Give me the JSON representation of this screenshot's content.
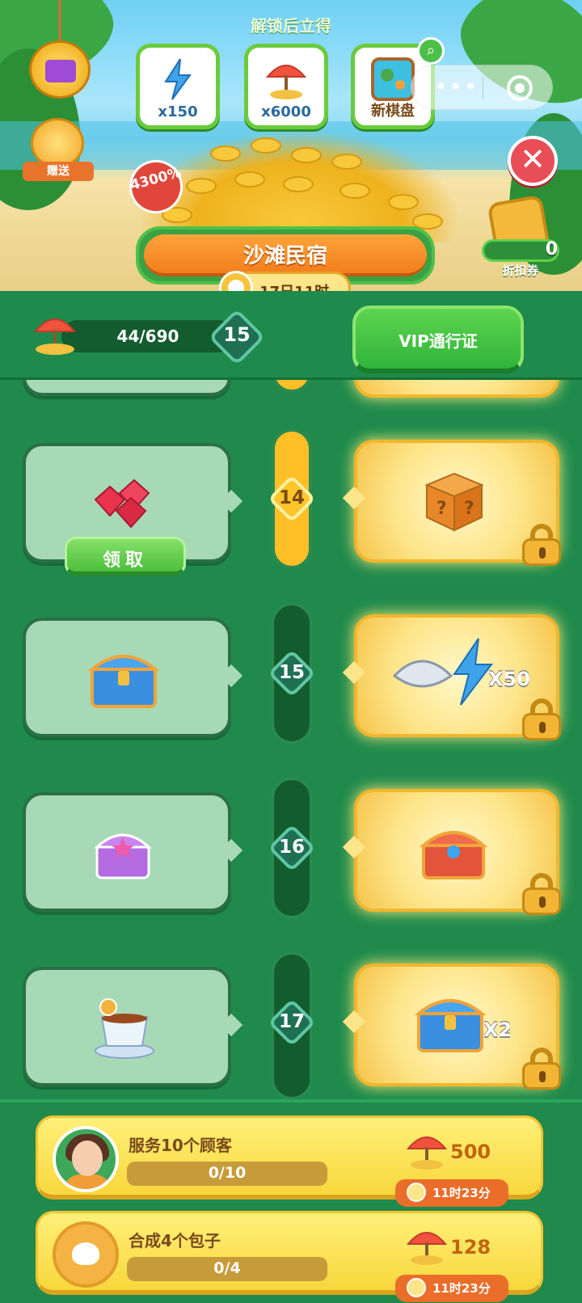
{
  "hero": {
    "unlock_title": "解锁后立得",
    "rewards": [
      {
        "label": "x150",
        "icon": "lightning-energy-icon"
      },
      {
        "label": "x6000",
        "icon": "beach-umbrella-icon"
      },
      {
        "label": "新棋盘",
        "icon": "new-board-icon"
      }
    ],
    "gift_label": "赠送",
    "percent_badge": "4300%",
    "event_title": "沙滩民宿",
    "timer": "17日11时",
    "coupon_count": "0",
    "coupon_label": "折扣券"
  },
  "progress": {
    "value": "44/690",
    "level": "15",
    "vip_button": "VIP通行证"
  },
  "levels": [
    {
      "level": "14",
      "free_reward": "ruby-gems-icon",
      "vip_reward": "mystery-box-icon",
      "claim_label": "领取",
      "active": true
    },
    {
      "level": "15",
      "free_reward": "blue-chest-icon",
      "vip_reward": "shell-and-energy-icon",
      "vip_qty": "X50",
      "active": false
    },
    {
      "level": "16",
      "free_reward": "purple-chest-icon",
      "vip_reward": "red-chest-icon",
      "active": false
    },
    {
      "level": "17",
      "free_reward": "tea-cup-icon",
      "vip_reward": "blue-chest-icon",
      "vip_qty": "X2",
      "active": false
    }
  ],
  "tasks": [
    {
      "title": "服务10个顾客",
      "progress": "0/10",
      "reward": "500",
      "timer": "11时23分",
      "icon": "avatar"
    },
    {
      "title": "合成4个包子",
      "progress": "0/4",
      "reward": "128",
      "timer": "11时23分",
      "icon": "bun-icon"
    }
  ]
}
